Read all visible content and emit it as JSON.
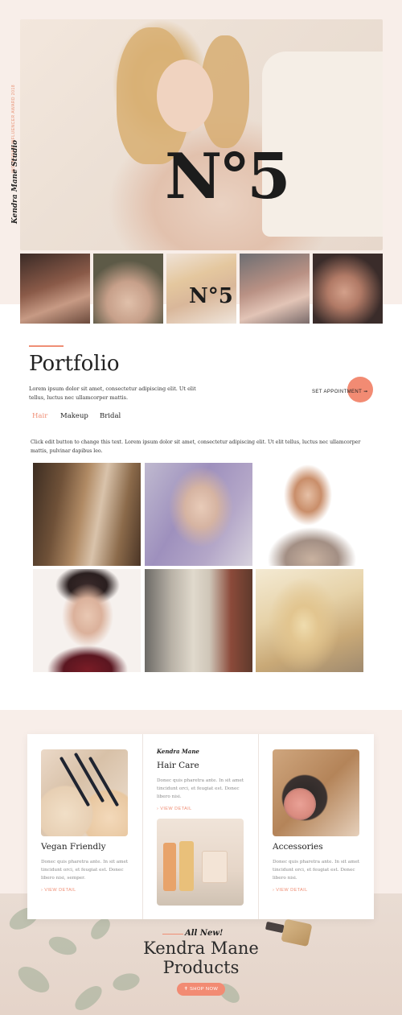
{
  "side": {
    "tagline": "INSTAGRAM INFLUENCER AWARD 2018",
    "brand": "Kendra Mane Studio"
  },
  "hero": {
    "image": "woman-in-no-sweater-photo",
    "shirt_text": "N°5"
  },
  "thumbnails": [
    {
      "name": "thumbnail-1"
    },
    {
      "name": "thumbnail-2"
    },
    {
      "name": "thumbnail-3"
    },
    {
      "name": "thumbnail-4"
    },
    {
      "name": "thumbnail-5"
    }
  ],
  "portfolio": {
    "title": "Portfolio",
    "intro": "Lorem ipsum dolor sit amet, consectetur adipiscing elit. Ut elit tellus, luctus nec ullamcorper mattis.",
    "appointment_label": "SET APPOINTMENT ➞",
    "tabs": [
      {
        "label": "Hair",
        "active": true
      },
      {
        "label": "Makeup",
        "active": false
      },
      {
        "label": "Bridal",
        "active": false
      }
    ],
    "description": "Click edit button to change this text. Lorem ipsum dolor sit amet, consectetur adipiscing elit. Ut elit tellus, luctus nec ullamcorper mattis, pulvinar dapibus leo."
  },
  "products": {
    "brand_script": "Kendra Mane",
    "items": [
      {
        "title": "Vegan Friendly",
        "desc": "Donec quis pharetra ante. In sit amet tincidunt orci, et feugiat est. Donec libero nisi, semper.",
        "link": "› VIEW DETAIL"
      },
      {
        "title": "Hair Care",
        "desc": "Donec quis pharetra ante. In sit amet tincidunt orci, et feugiat est. Donec libero nisi.",
        "link": "› VIEW DETAIL"
      },
      {
        "title": "Accessories",
        "desc": "Donec quis pharetra ante. In sit amet tincidunt orci, et feugiat est. Donec libero nisi.",
        "link": "› VIEW DETAIL"
      }
    ]
  },
  "promo": {
    "kicker": "All New!",
    "title_line1": "Kendra Mane",
    "title_line2": "Products",
    "button": "✝ SHOP NOW"
  },
  "colors": {
    "accent": "#ef8e75",
    "band": "#f8eee9"
  }
}
